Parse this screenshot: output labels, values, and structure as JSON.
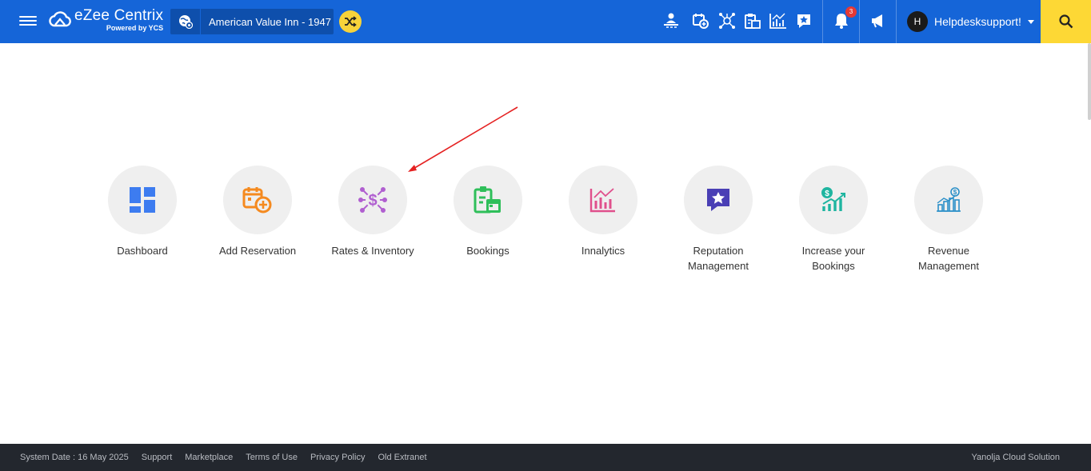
{
  "header": {
    "logo_title": "eZee Centrix",
    "logo_sub": "Powered by YCS",
    "property_name": "American Value Inn -  1947",
    "notification_count": "3",
    "user_initial": "H",
    "user_name": "Helpdesksupport!",
    "accent_color": "#1565d8",
    "search_color": "#fdd835",
    "tool_icons": [
      "front-desk-icon",
      "add-reservation-icon",
      "rates-inventory-icon",
      "bookings-icon",
      "innalytics-icon",
      "reputation-icon",
      "notification-bell-icon",
      "announcement-icon"
    ]
  },
  "modules": [
    {
      "label": "Dashboard",
      "icon": "dashboard-icon",
      "color": "#3d7cf0"
    },
    {
      "label": "Add Reservation",
      "icon": "add-reservation-icon",
      "color": "#f58a1f"
    },
    {
      "label": "Rates & Inventory",
      "icon": "rates-inventory-icon",
      "color": "#b05fd0"
    },
    {
      "label": "Bookings",
      "icon": "bookings-icon",
      "color": "#2fbf5a"
    },
    {
      "label": "Innalytics",
      "icon": "innalytics-icon",
      "color": "#e0508c"
    },
    {
      "label": "Reputation Management",
      "icon": "reputation-icon",
      "color": "#4a3fb5"
    },
    {
      "label": "Increase your Bookings",
      "icon": "increase-bookings-icon",
      "color": "#1fb5a0"
    },
    {
      "label": "Revenue Management",
      "icon": "revenue-management-icon",
      "color": "#2a8fc8"
    }
  ],
  "footer": {
    "system_date": "System Date : 16 May 2025",
    "links": [
      "Support",
      "Marketplace",
      "Terms of Use",
      "Privacy Policy",
      "Old Extranet"
    ],
    "company": "Yanolja Cloud Solution"
  }
}
